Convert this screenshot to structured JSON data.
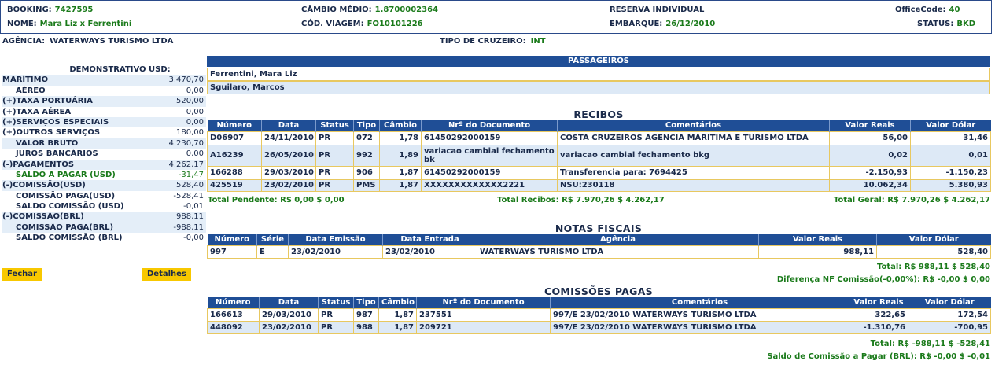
{
  "header": {
    "booking_label": "BOOKING:",
    "booking": "7427595",
    "nome_label": "NOME:",
    "nome": "Mara Liz x Ferrentini",
    "cambio_label": "CÂMBIO MÉDIO:",
    "cambio": "1.8700002364",
    "cod_label": "CÓD. VIAGEM:",
    "cod": "FO10101226",
    "reserva": "RESERVA INDIVIDUAL",
    "embarque_label": "EMBARQUE:",
    "embarque": "26/12/2010",
    "office_label": "OfficeCode:",
    "office": "40",
    "status_label": "STATUS:",
    "status": "BKD"
  },
  "agencia": {
    "label": "AGÊNCIA:",
    "value": "WATERWAYS TURISMO LTDA"
  },
  "tipo_cruzeiro": {
    "label": "TIPO DE CRUZEIRO:",
    "value": "INT"
  },
  "summary": {
    "title": "DEMONSTRATIVO USD:",
    "rows": [
      {
        "label": "MARÍTIMO",
        "value": "3.470,70"
      },
      {
        "label": "AÉREO",
        "value": "0,00"
      },
      {
        "label": "(+)TAXA PORTUÁRIA",
        "value": "520,00"
      },
      {
        "label": "(+)TAXA AÉREA",
        "value": "0,00"
      },
      {
        "label": "(+)SERVIÇOS ESPECIAIS",
        "value": "0,00"
      },
      {
        "label": "(+)OUTROS SERVIÇOS",
        "value": "180,00"
      },
      {
        "label": "VALOR BRUTO",
        "value": "4.230,70"
      },
      {
        "label": "JUROS BANCÁRIOS",
        "value": "0,00"
      },
      {
        "label": "(-)PAGAMENTOS",
        "value": "4.262,17"
      },
      {
        "label": "SALDO A PAGAR (USD)",
        "value": "-31,47"
      },
      {
        "label": "(-)COMISSÃO(USD)",
        "value": "528,40"
      },
      {
        "label": "COMISSÃO PAGA(USD)",
        "value": "-528,41"
      },
      {
        "label": "SALDO COMISSÃO (USD)",
        "value": "-0,01"
      },
      {
        "label": "(-)COMISSÃO(BRL)",
        "value": "988,11"
      },
      {
        "label": "COMISSÃO PAGA(BRL)",
        "value": "-988,11"
      },
      {
        "label": "SALDO COMISSÃO (BRL)",
        "value": "-0,00"
      }
    ]
  },
  "buttons": {
    "fechar": "Fechar",
    "detalhes": "Detalhes"
  },
  "passageiros": {
    "title": "PASSAGEIROS",
    "names": [
      "Ferrentini, Mara Liz",
      "Sguilaro, Marcos"
    ]
  },
  "recibos": {
    "title": "RECIBOS",
    "headers": [
      "Número",
      "Data",
      "Status",
      "Tipo",
      "Câmbio",
      "Nrº do Documento",
      "Comentários",
      "Valor Reais",
      "Valor Dólar"
    ],
    "rows": [
      [
        "D06907",
        "24/11/2010",
        "PR",
        "072",
        "1,78",
        "61450292000159",
        "COSTA CRUZEIROS AGENCIA MARITIMA E TURISMO LTDA",
        "56,00",
        "31,46"
      ],
      [
        "A16239",
        "26/05/2010",
        "PR",
        "992",
        "1,89",
        "variacao cambial fechamento bk",
        "variacao cambial fechamento bkg",
        "0,02",
        "0,01"
      ],
      [
        "166288",
        "29/03/2010",
        "PR",
        "906",
        "1,87",
        "61450292000159",
        "Transferencia para: 7694425",
        "-2.150,93",
        "-1.150,23"
      ],
      [
        "425519",
        "23/02/2010",
        "PR",
        "PMS",
        "1,87",
        "XXXXXXXXXXXXX2221",
        "NSU:230118",
        "10.062,34",
        "5.380,93"
      ]
    ],
    "total_pendente": "Total Pendente: R$ 0,00  $ 0,00",
    "total_recibos": "Total Recibos: R$ 7.970,26  $ 4.262,17",
    "total_geral": "Total Geral: R$ 7.970,26  $ 4.262,17"
  },
  "notas": {
    "title": "NOTAS FISCAIS",
    "headers": [
      "Número",
      "Série",
      "Data Emissão",
      "Data Entrada",
      "Agência",
      "Valor Reais",
      "Valor Dólar"
    ],
    "rows": [
      [
        "997",
        "E",
        "23/02/2010",
        "23/02/2010",
        "WATERWAYS TURISMO LTDA",
        "988,11",
        "528,40"
      ]
    ],
    "total": "Total: R$ 988,11  $ 528,40",
    "diferenca": "Diferença NF Comissão(-0,00%): R$ -0,00  $ 0,00"
  },
  "comissoes": {
    "title": "COMISSÕES PAGAS",
    "headers": [
      "Número",
      "Data",
      "Status",
      "Tipo",
      "Câmbio",
      "Nrº do Documento",
      "Comentários",
      "Valor Reais",
      "Valor Dólar"
    ],
    "rows": [
      [
        "166613",
        "29/03/2010",
        "PR",
        "987",
        "1,87",
        "237551",
        "997/E 23/02/2010 WATERWAYS TURISMO LTDA",
        "322,65",
        "172,54"
      ],
      [
        "448092",
        "23/02/2010",
        "PR",
        "988",
        "1,87",
        "209721",
        "997/E 23/02/2010 WATERWAYS TURISMO LTDA",
        "-1.310,76",
        "-700,95"
      ]
    ],
    "total": "Total: R$ -988,11  $ -528,41",
    "saldo": "Saldo de Comissão a Pagar (BRL): R$ -0,00  $ -0,01"
  },
  "colors": {
    "header_blue": "#1f4e96",
    "row_alt": "#dde9f6",
    "border_gold": "#e8c860",
    "value_green": "#1a7a1a",
    "button_yellow": "#f8c800"
  }
}
